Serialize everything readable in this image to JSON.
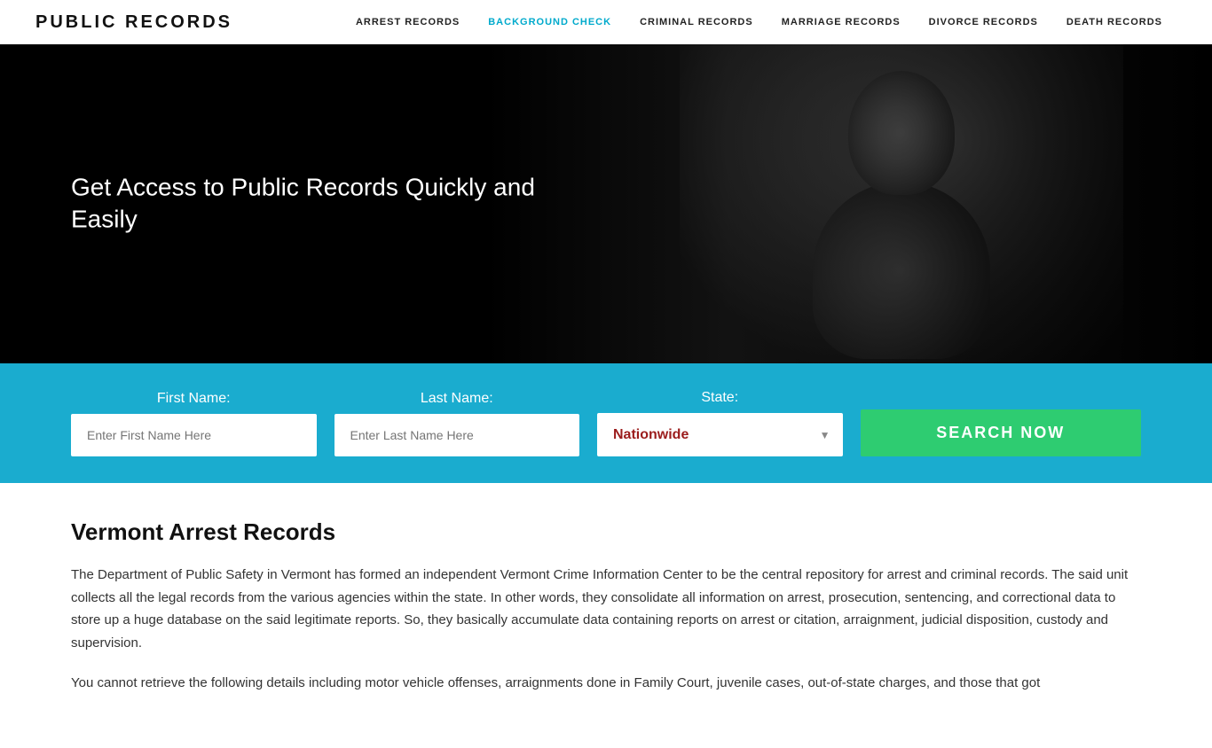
{
  "header": {
    "logo": "PUBLIC RECORDS",
    "nav": [
      {
        "label": "ARREST RECORDS",
        "active": false
      },
      {
        "label": "BACKGROUND CHECK",
        "active": true
      },
      {
        "label": "CRIMINAL RECORDS",
        "active": false
      },
      {
        "label": "MARRIAGE RECORDS",
        "active": false
      },
      {
        "label": "DIVORCE RECORDS",
        "active": false
      },
      {
        "label": "DEATH RECORDS",
        "active": false
      }
    ]
  },
  "hero": {
    "title": "Get Access to Public Records Quickly and Easily"
  },
  "search": {
    "first_name_label": "First Name:",
    "first_name_placeholder": "Enter First Name Here",
    "last_name_label": "Last Name:",
    "last_name_placeholder": "Enter Last Name Here",
    "state_label": "State:",
    "state_value": "Nationwide",
    "button_label": "SEARCH NOW"
  },
  "content": {
    "heading": "Vermont Arrest Records",
    "paragraph1": "The Department of Public Safety in Vermont has formed an independent Vermont Crime Information Center to be the central repository for arrest and criminal records. The said unit collects all the legal records from the various agencies within the state. In other words, they consolidate all information on arrest, prosecution, sentencing, and correctional data to store up a huge database on the said legitimate reports. So, they basically accumulate data containing reports on arrest or citation, arraignment, judicial disposition, custody and supervision.",
    "paragraph2": "You cannot retrieve the following details including motor vehicle offenses, arraignments done in Family Court, juvenile cases, out-of-state charges, and those that got"
  }
}
